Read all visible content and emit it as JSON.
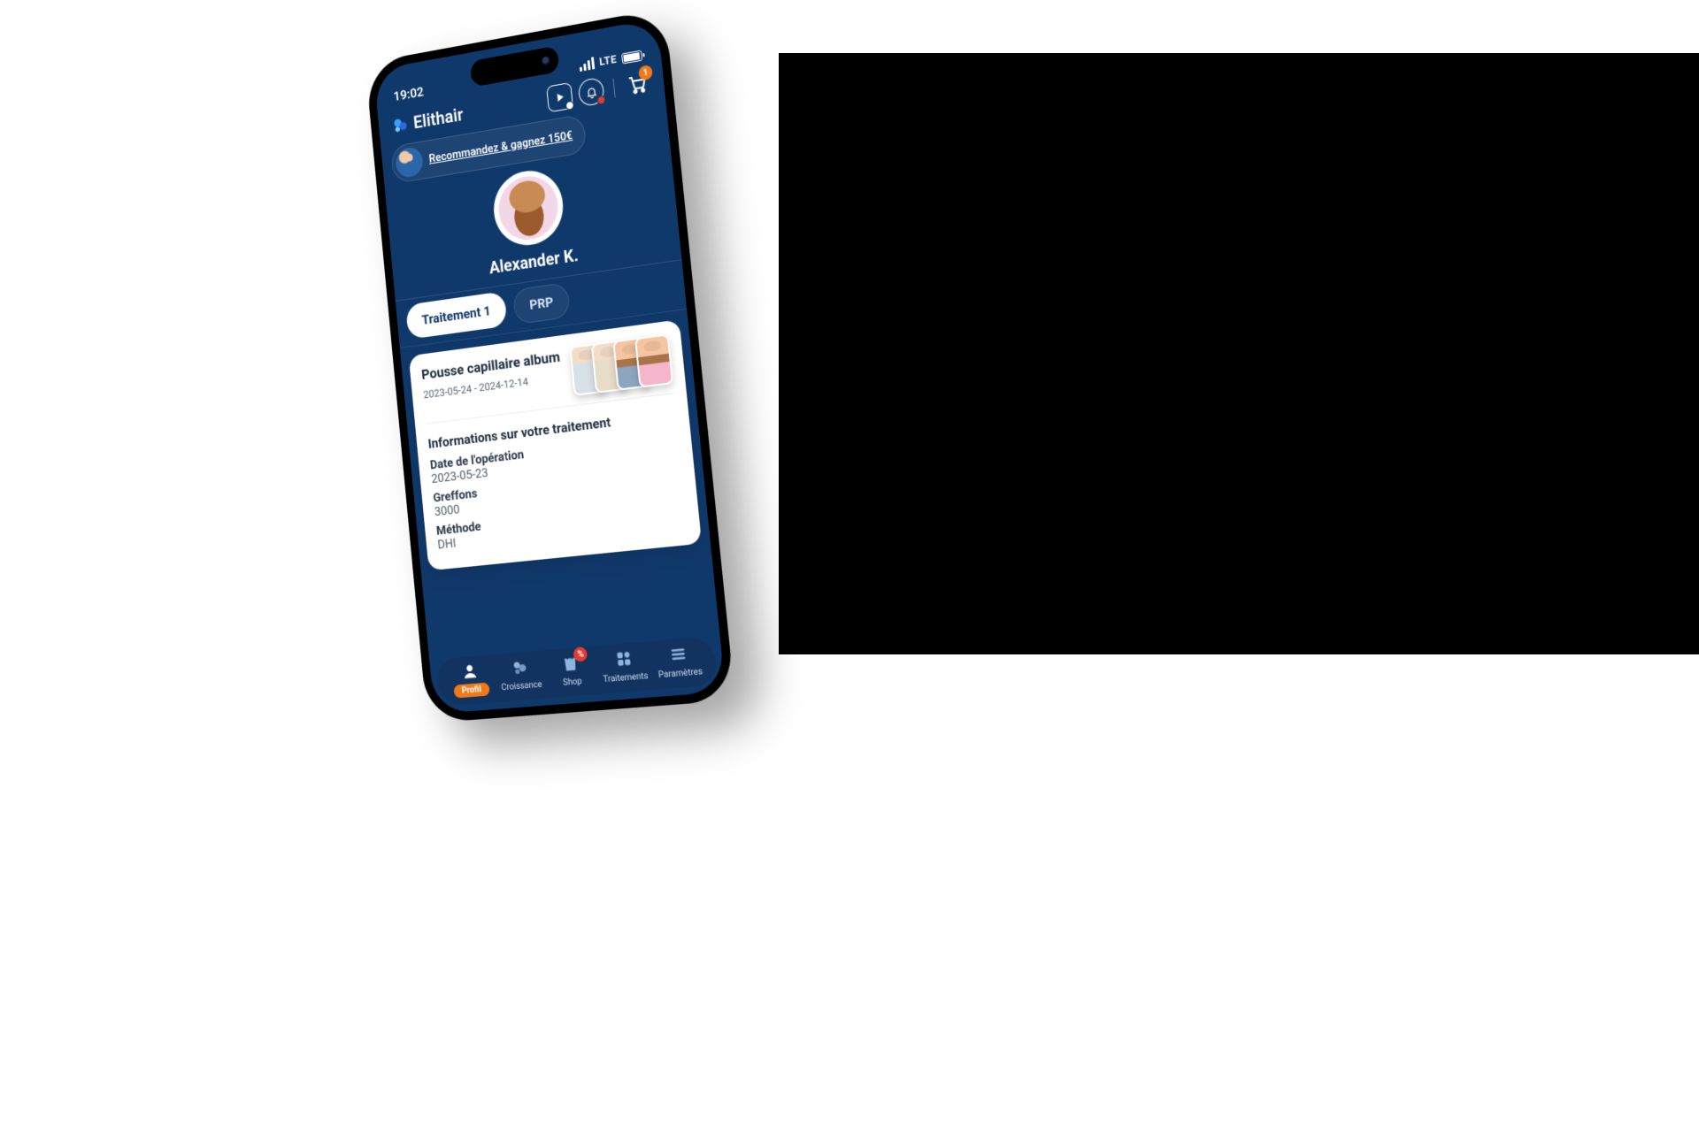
{
  "statusbar": {
    "time": "19:02",
    "network": "LTE"
  },
  "header": {
    "brand": "Elithair",
    "cart_count": "1"
  },
  "promo": {
    "text": "Recommandez & gagnez 150€"
  },
  "profile": {
    "name": "Alexander K."
  },
  "tabs": [
    {
      "label": "Traitement 1",
      "active": true
    },
    {
      "label": "PRP",
      "active": false
    }
  ],
  "album": {
    "title": "Pousse capillaire album",
    "date_range": "2023-05-24 - 2024-12-14"
  },
  "treatment": {
    "section_title": "Informations sur votre traitement",
    "operation_date_label": "Date de l'opération",
    "operation_date": "2023-05-23",
    "grafts_label": "Greffons",
    "grafts": "3000",
    "method_label": "Méthode",
    "method": "DHI"
  },
  "bottomnav": {
    "items": [
      {
        "label": "Profil",
        "active": true
      },
      {
        "label": "Croissance"
      },
      {
        "label": "Shop"
      },
      {
        "label": "Traitements"
      },
      {
        "label": "Paramètres"
      }
    ]
  }
}
